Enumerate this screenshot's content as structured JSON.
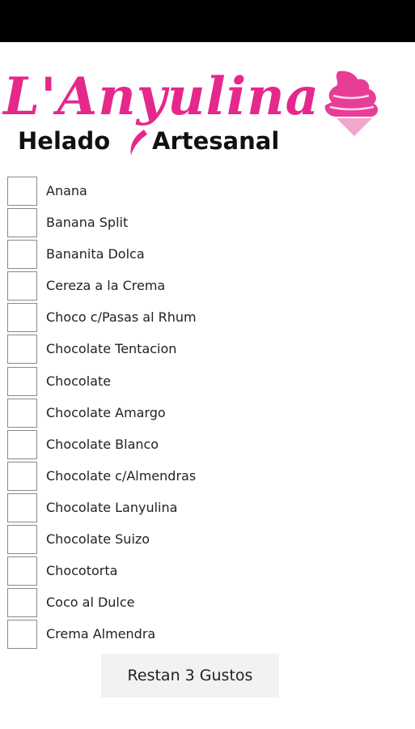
{
  "logo": {
    "brand_name": "L'Anyulina",
    "tagline_word1": "Helado",
    "tagline_word2": "Artesanal",
    "brand_color": "#e5288c",
    "icon": "ice-cream-cone-icon"
  },
  "flavors": [
    {
      "label": "Anana",
      "checked": false
    },
    {
      "label": "Banana Split",
      "checked": false
    },
    {
      "label": "Bananita Dolca",
      "checked": false
    },
    {
      "label": "Cereza a la Crema",
      "checked": false
    },
    {
      "label": "Choco c/Pasas al Rhum",
      "checked": false
    },
    {
      "label": "Chocolate Tentacion",
      "checked": false
    },
    {
      "label": "Chocolate",
      "checked": false
    },
    {
      "label": "Chocolate Amargo",
      "checked": false
    },
    {
      "label": "Chocolate Blanco",
      "checked": false
    },
    {
      "label": "Chocolate c/Almendras",
      "checked": false
    },
    {
      "label": "Chocolate Lanyulina",
      "checked": false
    },
    {
      "label": "Chocolate Suizo",
      "checked": false
    },
    {
      "label": "Chocotorta",
      "checked": false
    },
    {
      "label": "Coco al Dulce",
      "checked": false
    },
    {
      "label": "Crema Almendra",
      "checked": false
    }
  ],
  "footer": {
    "button_label": "Restan 3 Gustos"
  }
}
